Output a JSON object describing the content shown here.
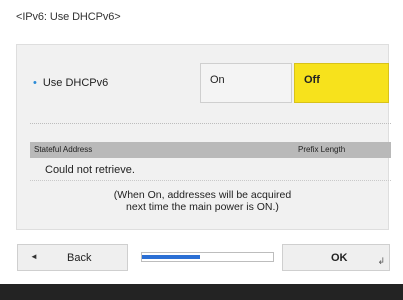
{
  "title": "<IPv6: Use DHCPv6>",
  "setting": {
    "label": "Use DHCPv6",
    "options": [
      "On",
      "Off"
    ],
    "selected": "Off"
  },
  "table": {
    "columns": [
      "Stateful Address",
      "Prefix Length"
    ],
    "cell": "Could not retrieve."
  },
  "note": [
    "(When On, addresses will be acquired",
    "next time the main power is ON.)"
  ],
  "buttons": {
    "back": "Back",
    "ok": "OK"
  },
  "progress_fraction": 0.44,
  "colors": {
    "selected": "#f7e21c",
    "progress": "#2b6fd4",
    "bullet": "#2a8ad6"
  },
  "icons": {
    "back": "left-triangle-icon",
    "enter": "enter-return-icon"
  }
}
